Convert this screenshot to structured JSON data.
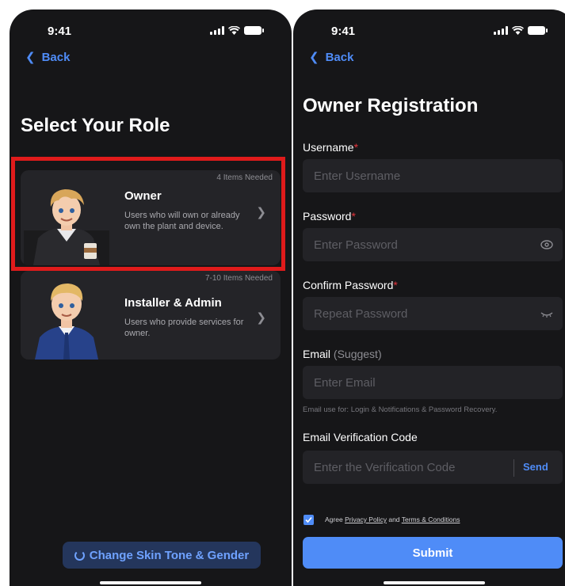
{
  "left": {
    "status_time": "9:41",
    "back_label": "Back",
    "title": "Select Your Role",
    "owner_card": {
      "badge": "4 Items Needed",
      "title": "Owner",
      "description": "Users who will own or already own the plant and device.",
      "avatar_icon": "owner-avatar"
    },
    "installer_card": {
      "badge": "7-10 Items Needed",
      "title": "Installer & Admin",
      "description": "Users who provide services for owner.",
      "avatar_icon": "installer-avatar"
    },
    "skin_button": "Change Skin Tone & Gender"
  },
  "right": {
    "status_time": "9:41",
    "back_label": "Back",
    "title": "Owner Registration",
    "username": {
      "label": "Username",
      "required": "*",
      "placeholder": "Enter Username"
    },
    "password": {
      "label": "Password",
      "required": "*",
      "placeholder": "Enter Password"
    },
    "confirm_password": {
      "label": "Confirm Password",
      "required": "*",
      "placeholder": "Repeat Password"
    },
    "email": {
      "label": "Email",
      "hint": "(Suggest)",
      "placeholder": "Enter Email",
      "note": "Email use for: Login & Notifications & Password Recovery."
    },
    "verification": {
      "label": "Email Verification Code",
      "placeholder": "Enter the Verification Code",
      "send": "Send"
    },
    "agree": {
      "prefix": "Agree",
      "privacy": "Privacy Policy",
      "and": "and",
      "terms": "Terms & Conditions",
      "checked": true
    },
    "submit_label": "Submit"
  },
  "colors": {
    "background": "#161618",
    "accent": "#4f8cf7",
    "required": "#e2333b",
    "highlight": "#e01b1b"
  }
}
